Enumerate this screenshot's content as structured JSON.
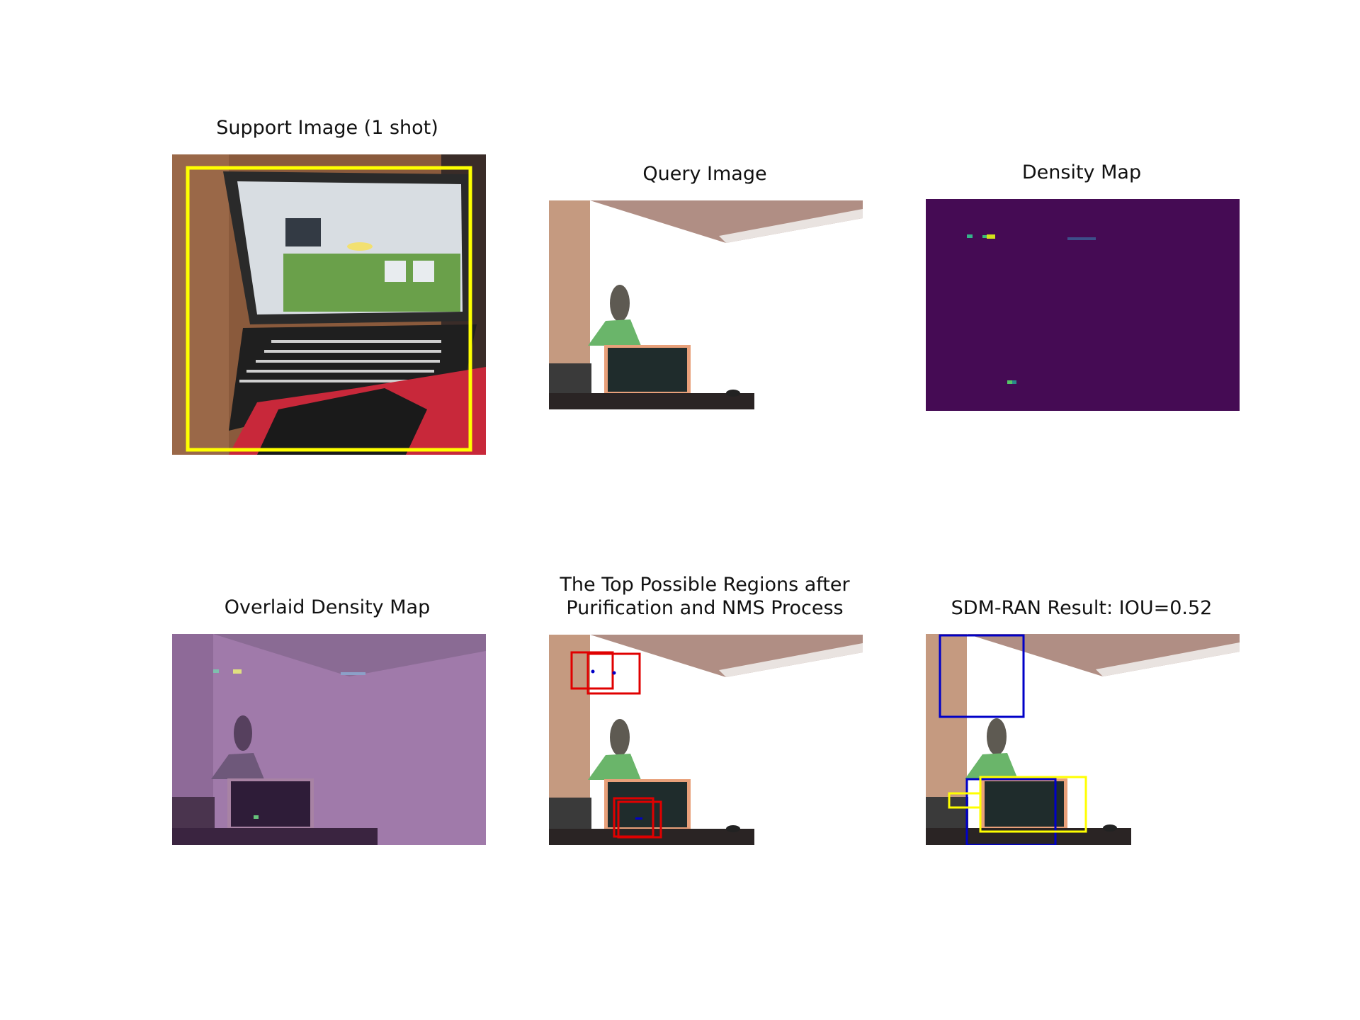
{
  "figure": {
    "panels": [
      {
        "id": "support",
        "title": "Support Image (1 shot)"
      },
      {
        "id": "query",
        "title": "Query Image"
      },
      {
        "id": "density",
        "title": "Density Map"
      },
      {
        "id": "overlay",
        "title": "Overlaid Density Map"
      },
      {
        "id": "regions",
        "title": "The Top Possible Regions after\nPurification and NMS Process"
      },
      {
        "id": "result",
        "title": "SDM-RAN Result: IOU=0.52"
      }
    ],
    "colors": {
      "support_box": "#ffff00",
      "candidate_box": "#e00000",
      "prediction_box": "#0000c8",
      "ground_truth_box": "#ffff00",
      "density_background": "#450b54",
      "overlay_tint": "#a07aaa"
    }
  }
}
